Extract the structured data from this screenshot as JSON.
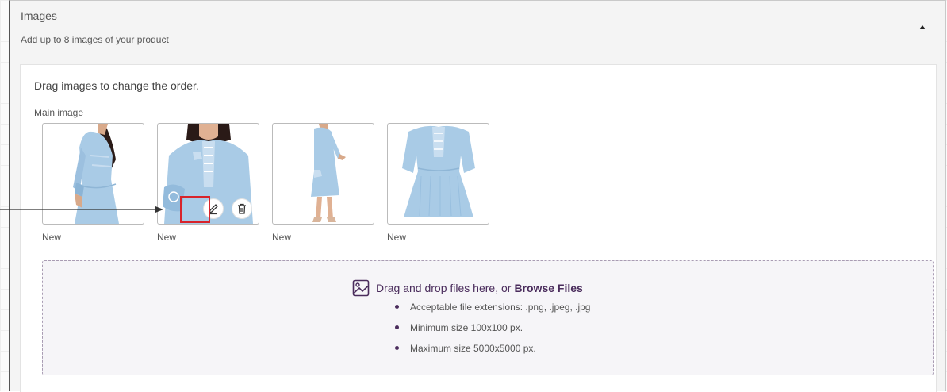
{
  "section": {
    "title": "Images",
    "subtitle": "Add up to 8 images of your product"
  },
  "uploader": {
    "hint": "Drag images to change the order.",
    "main_image_label": "Main image",
    "images": [
      {
        "status": "New",
        "pose": "side view, model with long hair"
      },
      {
        "status": "New",
        "pose": "front view, close-up"
      },
      {
        "status": "New",
        "pose": "full length side view"
      },
      {
        "status": "New",
        "pose": "dress only"
      }
    ],
    "actions": {
      "edit_icon": "pencil-icon",
      "delete_icon": "trash-icon"
    }
  },
  "dropzone": {
    "prompt": "Drag and drop files here, or",
    "browse_label": "Browse Files",
    "rules": [
      "Acceptable file extensions: .png, .jpeg, .jpg",
      "Minimum size 100x100 px.",
      "Maximum size 5000x5000 px."
    ]
  },
  "colors": {
    "accent": "#4a2c5c",
    "highlight": "#d8232a",
    "dress": "#a9cbe6"
  }
}
